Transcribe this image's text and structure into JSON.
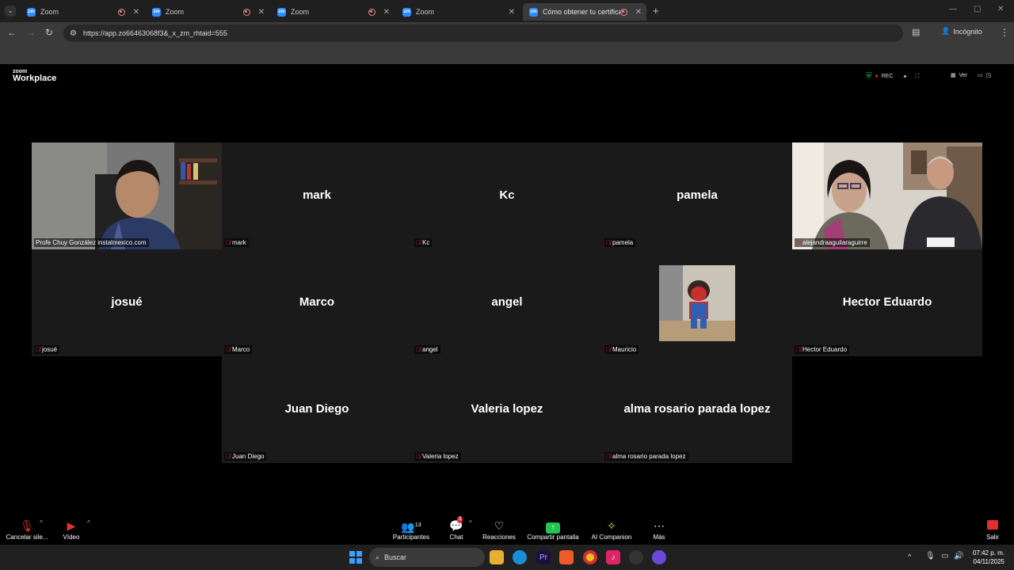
{
  "browser": {
    "tabs": [
      {
        "label": "Zoom",
        "active": false
      },
      {
        "label": "Zoom",
        "active": false
      },
      {
        "label": "Zoom",
        "active": false
      },
      {
        "label": "Zoom",
        "active": false
      },
      {
        "label": "Cómo obtener tu certificad",
        "active": true
      }
    ],
    "url": "https://app.zo66463068f3&_x_zm_rhtaid=555",
    "incognito_label": "Incógnito"
  },
  "zoom": {
    "logo_small": "zoom",
    "logo_big": "Workplace",
    "rec_label": "REC",
    "view_label": "Ver",
    "participants": [
      {
        "display": "",
        "tag": "Profe Chuy González instalmexico.com",
        "video": true,
        "muted": false
      },
      {
        "display": "mark",
        "tag": "mark",
        "video": false,
        "muted": true
      },
      {
        "display": "Kc",
        "tag": "Kc",
        "video": false,
        "muted": true
      },
      {
        "display": "pamela",
        "tag": "pamela",
        "video": false,
        "muted": true
      },
      {
        "display": "",
        "tag": "alejandraaguilaraguirre",
        "video": true,
        "muted": true
      },
      {
        "display": "josué",
        "tag": "josué",
        "video": false,
        "muted": true
      },
      {
        "display": "Marco",
        "tag": "Marco",
        "video": false,
        "muted": true
      },
      {
        "display": "angel",
        "tag": "angel",
        "video": false,
        "muted": true
      },
      {
        "display": "",
        "tag": "Mauricio",
        "video": false,
        "muted": true
      },
      {
        "display": "Hector Eduardo",
        "tag": "Hector Eduardo",
        "video": false,
        "muted": true
      },
      {
        "display": "Juan Diego",
        "tag": "Juan Diego",
        "video": false,
        "muted": true
      },
      {
        "display": "Valeria lopez",
        "tag": "Valeria lopez",
        "video": false,
        "muted": true
      },
      {
        "display": "alma rosario parada lopez",
        "tag": "alma rosario parada lopez",
        "video": false,
        "muted": true
      }
    ],
    "toolbar": {
      "mute_label": "Cancelar sile...",
      "video_label": "Vídeo",
      "participants_label": "Participantes",
      "participants_count": "13",
      "chat_label": "Chat",
      "chat_badge": "3",
      "reactions_label": "Reacciones",
      "share_label": "Compartir pantalla",
      "ai_label": "AI Companion",
      "more_label": "Más",
      "leave_label": "Salir"
    }
  },
  "taskbar": {
    "search_placeholder": "Buscar",
    "time": "07:42 p. m.",
    "date": "04/11/2025"
  }
}
